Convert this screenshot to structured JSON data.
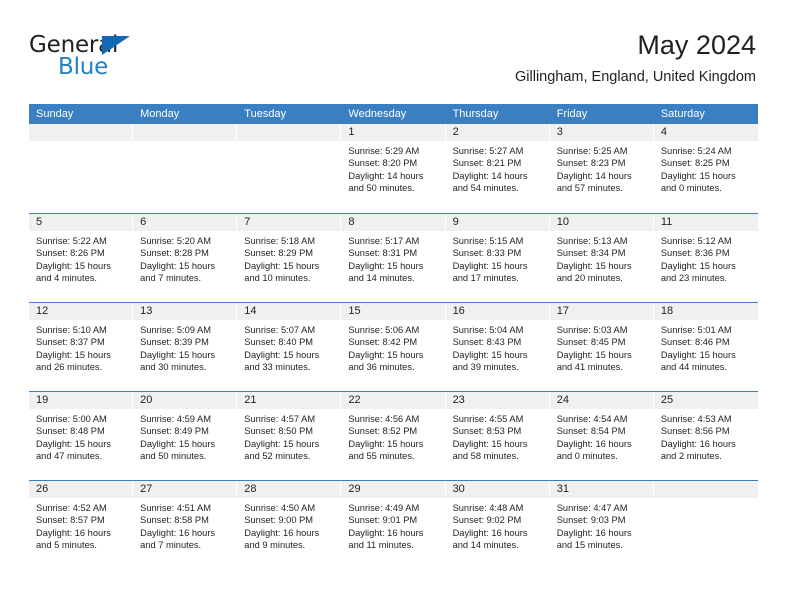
{
  "brand": {
    "name_top": "General",
    "name_bottom": "Blue",
    "triangle_color": "#1268b3",
    "blue_text_color": "#2280c3"
  },
  "header": {
    "title": "May 2024",
    "subtitle": "Gillingham, England, United Kingdom"
  },
  "theme": {
    "header_blue": "#3a7fc1",
    "daynum_gray": "#f0f0f0",
    "text": "#231f20"
  },
  "weekdays": [
    "Sunday",
    "Monday",
    "Tuesday",
    "Wednesday",
    "Thursday",
    "Friday",
    "Saturday"
  ],
  "labels": {
    "sunrise": "Sunrise:",
    "sunset": "Sunset:",
    "daylight": "Daylight:"
  },
  "weeks": [
    [
      {
        "day": "",
        "sunrise": "",
        "sunset": "",
        "daylight": ""
      },
      {
        "day": "",
        "sunrise": "",
        "sunset": "",
        "daylight": ""
      },
      {
        "day": "",
        "sunrise": "",
        "sunset": "",
        "daylight": ""
      },
      {
        "day": "1",
        "sunrise": "Sunrise: 5:29 AM",
        "sunset": "Sunset: 8:20 PM",
        "daylight": "Daylight: 14 hours and 50 minutes."
      },
      {
        "day": "2",
        "sunrise": "Sunrise: 5:27 AM",
        "sunset": "Sunset: 8:21 PM",
        "daylight": "Daylight: 14 hours and 54 minutes."
      },
      {
        "day": "3",
        "sunrise": "Sunrise: 5:25 AM",
        "sunset": "Sunset: 8:23 PM",
        "daylight": "Daylight: 14 hours and 57 minutes."
      },
      {
        "day": "4",
        "sunrise": "Sunrise: 5:24 AM",
        "sunset": "Sunset: 8:25 PM",
        "daylight": "Daylight: 15 hours and 0 minutes."
      }
    ],
    [
      {
        "day": "5",
        "sunrise": "Sunrise: 5:22 AM",
        "sunset": "Sunset: 8:26 PM",
        "daylight": "Daylight: 15 hours and 4 minutes."
      },
      {
        "day": "6",
        "sunrise": "Sunrise: 5:20 AM",
        "sunset": "Sunset: 8:28 PM",
        "daylight": "Daylight: 15 hours and 7 minutes."
      },
      {
        "day": "7",
        "sunrise": "Sunrise: 5:18 AM",
        "sunset": "Sunset: 8:29 PM",
        "daylight": "Daylight: 15 hours and 10 minutes."
      },
      {
        "day": "8",
        "sunrise": "Sunrise: 5:17 AM",
        "sunset": "Sunset: 8:31 PM",
        "daylight": "Daylight: 15 hours and 14 minutes."
      },
      {
        "day": "9",
        "sunrise": "Sunrise: 5:15 AM",
        "sunset": "Sunset: 8:33 PM",
        "daylight": "Daylight: 15 hours and 17 minutes."
      },
      {
        "day": "10",
        "sunrise": "Sunrise: 5:13 AM",
        "sunset": "Sunset: 8:34 PM",
        "daylight": "Daylight: 15 hours and 20 minutes."
      },
      {
        "day": "11",
        "sunrise": "Sunrise: 5:12 AM",
        "sunset": "Sunset: 8:36 PM",
        "daylight": "Daylight: 15 hours and 23 minutes."
      }
    ],
    [
      {
        "day": "12",
        "sunrise": "Sunrise: 5:10 AM",
        "sunset": "Sunset: 8:37 PM",
        "daylight": "Daylight: 15 hours and 26 minutes."
      },
      {
        "day": "13",
        "sunrise": "Sunrise: 5:09 AM",
        "sunset": "Sunset: 8:39 PM",
        "daylight": "Daylight: 15 hours and 30 minutes."
      },
      {
        "day": "14",
        "sunrise": "Sunrise: 5:07 AM",
        "sunset": "Sunset: 8:40 PM",
        "daylight": "Daylight: 15 hours and 33 minutes."
      },
      {
        "day": "15",
        "sunrise": "Sunrise: 5:06 AM",
        "sunset": "Sunset: 8:42 PM",
        "daylight": "Daylight: 15 hours and 36 minutes."
      },
      {
        "day": "16",
        "sunrise": "Sunrise: 5:04 AM",
        "sunset": "Sunset: 8:43 PM",
        "daylight": "Daylight: 15 hours and 39 minutes."
      },
      {
        "day": "17",
        "sunrise": "Sunrise: 5:03 AM",
        "sunset": "Sunset: 8:45 PM",
        "daylight": "Daylight: 15 hours and 41 minutes."
      },
      {
        "day": "18",
        "sunrise": "Sunrise: 5:01 AM",
        "sunset": "Sunset: 8:46 PM",
        "daylight": "Daylight: 15 hours and 44 minutes."
      }
    ],
    [
      {
        "day": "19",
        "sunrise": "Sunrise: 5:00 AM",
        "sunset": "Sunset: 8:48 PM",
        "daylight": "Daylight: 15 hours and 47 minutes."
      },
      {
        "day": "20",
        "sunrise": "Sunrise: 4:59 AM",
        "sunset": "Sunset: 8:49 PM",
        "daylight": "Daylight: 15 hours and 50 minutes."
      },
      {
        "day": "21",
        "sunrise": "Sunrise: 4:57 AM",
        "sunset": "Sunset: 8:50 PM",
        "daylight": "Daylight: 15 hours and 52 minutes."
      },
      {
        "day": "22",
        "sunrise": "Sunrise: 4:56 AM",
        "sunset": "Sunset: 8:52 PM",
        "daylight": "Daylight: 15 hours and 55 minutes."
      },
      {
        "day": "23",
        "sunrise": "Sunrise: 4:55 AM",
        "sunset": "Sunset: 8:53 PM",
        "daylight": "Daylight: 15 hours and 58 minutes."
      },
      {
        "day": "24",
        "sunrise": "Sunrise: 4:54 AM",
        "sunset": "Sunset: 8:54 PM",
        "daylight": "Daylight: 16 hours and 0 minutes."
      },
      {
        "day": "25",
        "sunrise": "Sunrise: 4:53 AM",
        "sunset": "Sunset: 8:56 PM",
        "daylight": "Daylight: 16 hours and 2 minutes."
      }
    ],
    [
      {
        "day": "26",
        "sunrise": "Sunrise: 4:52 AM",
        "sunset": "Sunset: 8:57 PM",
        "daylight": "Daylight: 16 hours and 5 minutes."
      },
      {
        "day": "27",
        "sunrise": "Sunrise: 4:51 AM",
        "sunset": "Sunset: 8:58 PM",
        "daylight": "Daylight: 16 hours and 7 minutes."
      },
      {
        "day": "28",
        "sunrise": "Sunrise: 4:50 AM",
        "sunset": "Sunset: 9:00 PM",
        "daylight": "Daylight: 16 hours and 9 minutes."
      },
      {
        "day": "29",
        "sunrise": "Sunrise: 4:49 AM",
        "sunset": "Sunset: 9:01 PM",
        "daylight": "Daylight: 16 hours and 11 minutes."
      },
      {
        "day": "30",
        "sunrise": "Sunrise: 4:48 AM",
        "sunset": "Sunset: 9:02 PM",
        "daylight": "Daylight: 16 hours and 14 minutes."
      },
      {
        "day": "31",
        "sunrise": "Sunrise: 4:47 AM",
        "sunset": "Sunset: 9:03 PM",
        "daylight": "Daylight: 16 hours and 15 minutes."
      },
      {
        "day": "",
        "sunrise": "",
        "sunset": "",
        "daylight": ""
      }
    ]
  ]
}
